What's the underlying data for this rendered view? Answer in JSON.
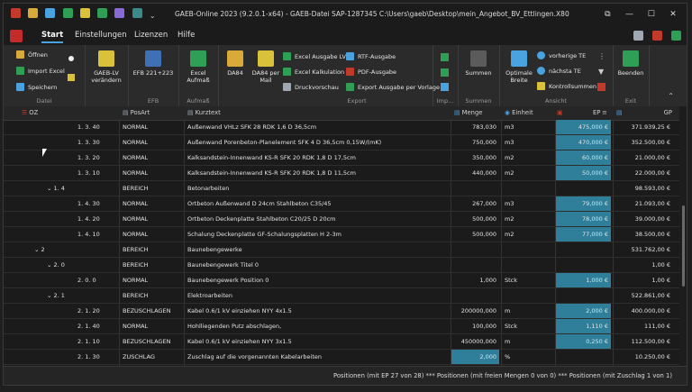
{
  "window": {
    "title": "GAEB-Online 2023 (9.2.0.1-x64) - GAEB-Datei  SAP-1287345 C:\\Users\\gaeb\\Desktop\\mein_Angebot_BV_Ettlingen.X80",
    "controls": [
      "⧉",
      "—",
      "☐",
      "✕"
    ]
  },
  "tabs": [
    "Start",
    "Einstellungen",
    "Lizenzen",
    "Hilfe"
  ],
  "ribbon": {
    "datei": {
      "label": "Datei",
      "items": [
        "Öffnen",
        "Import Excel",
        "Speichern"
      ]
    },
    "gaeb": {
      "button": "GAEB-LV verändern"
    },
    "efb": {
      "label": "EFB",
      "button": "EFB 221+223"
    },
    "aufmass": {
      "label": "Aufmaß",
      "button": "Excel Aufmaß"
    },
    "da84": {
      "button": "DA84"
    },
    "da84mail": {
      "button": "DA84 per Mail"
    },
    "export": {
      "label": "Export",
      "items": [
        "Excel Ausgabe LV",
        "Excel Kalkulation",
        "Druckvorschau",
        "RTF-Ausgabe",
        "PDF-Ausgabe",
        "Export Ausgabe per Vorlage"
      ]
    },
    "imp": {
      "label": "Imp..."
    },
    "summen": {
      "label": "Summen",
      "button": "Summen"
    },
    "ansicht": {
      "label": "Ansicht",
      "button": "Optimale Breite",
      "items": [
        "vorherige TE",
        "nächsta TE",
        "Kontrollsummen"
      ]
    },
    "exit": {
      "label": "Exit",
      "button": "Beenden"
    }
  },
  "columns": {
    "oz": "OZ",
    "posart": "PosArt",
    "kurztext": "Kurztext",
    "menge": "Menge",
    "einheit": "Einheit",
    "ep": "EP",
    "gp": "GP"
  },
  "rows": [
    {
      "oz": "1. 3. 40",
      "posart": "NORMAL",
      "kurztext": "Außenwand VHLz SFK 28 RDK 1,6 D 36,5cm",
      "menge": "783,030",
      "einheit": "m3",
      "ep": "475,000 €",
      "gp": "371.939,25 €",
      "ephl": true
    },
    {
      "oz": "1. 3. 30",
      "posart": "NORMAL",
      "kurztext": "Außenwand Porenbeton-Planelement SFK 4 D 36,5cm 0,15W/(mK)",
      "menge": "750,000",
      "einheit": "m3",
      "ep": "470,000 €",
      "gp": "352.500,00 €",
      "ephl": true
    },
    {
      "oz": "1. 3. 20",
      "posart": "NORMAL",
      "kurztext": "Kalksandstein-Innenwand KS-R SFK 20 RDK 1,8 D 17,5cm",
      "menge": "350,000",
      "einheit": "m2",
      "ep": "60,000 €",
      "gp": "21.000,00 €",
      "ephl": true
    },
    {
      "oz": "1. 3. 10",
      "posart": "NORMAL",
      "kurztext": "Kalksandstein-Innenwand KS-R SFK 20 RDK 1,8 D 11,5cm",
      "menge": "440,000",
      "einheit": "m2",
      "ep": "50,000 €",
      "gp": "22.000,00 €",
      "ephl": true
    },
    {
      "oz": "⌄  1. 4",
      "posart": "BEREICH",
      "kurztext": "Betonarbeiten",
      "menge": "",
      "einheit": "",
      "ep": "",
      "gp": "98.593,00 €",
      "ephl": false
    },
    {
      "oz": "1. 4. 30",
      "posart": "NORMAL",
      "kurztext": "Ortbeton Außenwand D 24cm Stahlbeton C35/45",
      "menge": "267,000",
      "einheit": "m3",
      "ep": "79,000 €",
      "gp": "21.093,00 €",
      "ephl": true
    },
    {
      "oz": "1. 4. 20",
      "posart": "NORMAL",
      "kurztext": "Ortbeton Deckenplatte Stahlbeton C20/25 D 20cm",
      "menge": "500,000",
      "einheit": "m2",
      "ep": "78,000 €",
      "gp": "39.000,00 €",
      "ephl": true
    },
    {
      "oz": "1. 4. 10",
      "posart": "NORMAL",
      "kurztext": "Schalung Deckenplatte GF-Schalungsplatten H 2-3m",
      "menge": "500,000",
      "einheit": "m2",
      "ep": "77,000 €",
      "gp": "38.500,00 €",
      "ephl": true
    },
    {
      "oz": "⌄  2",
      "posart": "BEREICH",
      "kurztext": "Baunebengewerke",
      "menge": "",
      "einheit": "",
      "ep": "",
      "gp": "531.762,00 €",
      "ephl": false
    },
    {
      "oz": "⌄  2. 0",
      "posart": "BEREICH",
      "kurztext": "Baunebengewerk Titel 0",
      "menge": "",
      "einheit": "",
      "ep": "",
      "gp": "1,00 €",
      "ephl": false
    },
    {
      "oz": "2. 0. 0",
      "posart": "NORMAL",
      "kurztext": "Baunebengewerk Position 0",
      "menge": "1,000",
      "einheit": "Stck",
      "ep": "1,000 €",
      "gp": "1,00 €",
      "ephl": true
    },
    {
      "oz": "⌄  2. 1",
      "posart": "BEREICH",
      "kurztext": "Elektroarbeiten",
      "menge": "",
      "einheit": "",
      "ep": "",
      "gp": "522.861,00 €",
      "ephl": false
    },
    {
      "oz": "2. 1. 20",
      "posart": "BEZUSCHLAGEN",
      "kurztext": "Kabel 0.6/1 kV einziehen NYY 4x1.5",
      "menge": "200000,000",
      "einheit": "m",
      "ep": "2,000 €",
      "gp": "400.000,00 €",
      "ephl": true
    },
    {
      "oz": "2. 1. 40",
      "posart": "NORMAL",
      "kurztext": "Hohlliegenden Putz abschlagen,",
      "menge": "100,000",
      "einheit": "Stck",
      "ep": "1,110 €",
      "gp": "111,00 €",
      "ephl": true
    },
    {
      "oz": "2. 1. 10",
      "posart": "BEZUSCHLAGEN",
      "kurztext": "Kabel 0.6/1 kV einziehen NYY 3x1.5",
      "menge": "450000,000",
      "einheit": "m",
      "ep": "0,250 €",
      "gp": "112.500,00 €",
      "ephl": true
    },
    {
      "oz": "2. 1. 30",
      "posart": "ZUSCHLAG",
      "kurztext": "Zuschlag auf die vorgenannten Kabelarbeiten",
      "menge": "2,000",
      "einheit": "%",
      "ep": "",
      "gp": "10.250,00 €",
      "ephl": false,
      "mengehl": true
    }
  ],
  "status": "Positionen (mit EP 27 von 28) *** Positionen (mit freien Mengen 0 von 0) *** Positionen (mit Zuschlag 1 von 1)"
}
